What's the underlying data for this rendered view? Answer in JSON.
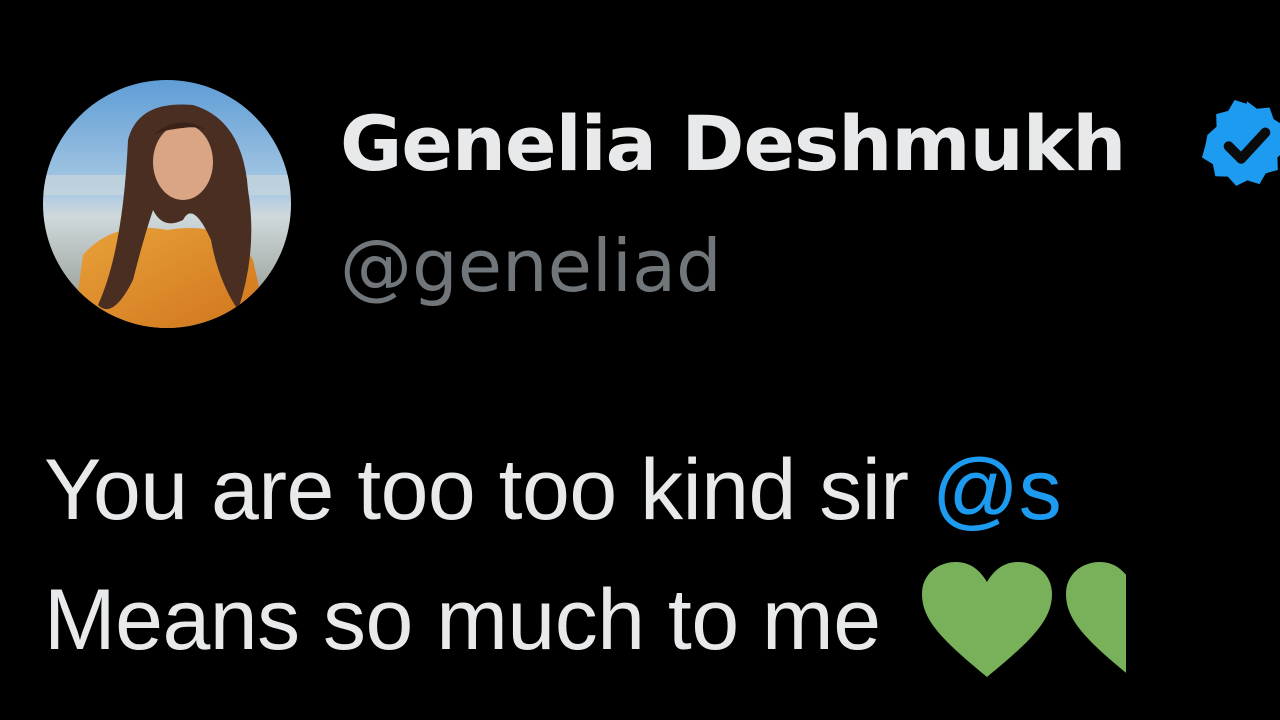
{
  "author": {
    "display_name": "Genelia Deshmukh",
    "handle": "@geneliad",
    "verified_icon": "verified-badge-icon",
    "avatar_alt": "profile photo"
  },
  "tweet": {
    "line1_text": "You are too too kind sir ",
    "line1_mention": "@s",
    "line2_text": "Means so much to me ",
    "emoji": "green-heart-emoji"
  },
  "colors": {
    "background": "#000000",
    "name": "#e7e9ea",
    "handle": "#71767b",
    "mention": "#1d9bf0",
    "verified": "#1d9bf0",
    "heart": "#78b159"
  }
}
